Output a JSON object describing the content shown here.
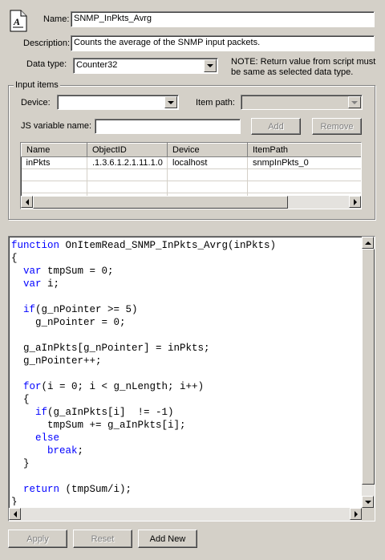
{
  "form": {
    "name_label": "Name:",
    "name_value": "SNMP_InPkts_Avrg",
    "description_label": "Description:",
    "description_value": "Counts the average of the SNMP input packets.",
    "datatype_label": "Data type:",
    "datatype_value": "Counter32",
    "note_line1": "NOTE: Return value from script must",
    "note_line2": "be same as selected data type."
  },
  "input_items": {
    "title": "Input items",
    "device_label": "Device:",
    "device_value": "",
    "itempath_label": "Item path:",
    "itempath_value": "",
    "jsvar_label": "JS variable name:",
    "jsvar_value": "",
    "add_label": "Add",
    "remove_label": "Remove",
    "columns": [
      "Name",
      "ObjectID",
      "Device",
      "ItemPath"
    ],
    "rows": [
      [
        "inPkts",
        ".1.3.6.1.2.1.11.1.0",
        "localhost",
        "snmpInPkts_0"
      ],
      [
        "",
        "",
        "",
        ""
      ],
      [
        "",
        "",
        "",
        ""
      ],
      [
        "",
        "",
        "",
        ""
      ]
    ]
  },
  "code": {
    "lines": [
      [
        {
          "t": "function",
          "k": 1
        },
        {
          "t": " OnItemRead_SNMP_InPkts_Avrg(inPkts)"
        }
      ],
      [
        {
          "t": "{"
        }
      ],
      [
        {
          "t": "  "
        },
        {
          "t": "var",
          "k": 1
        },
        {
          "t": " tmpSum = 0;"
        }
      ],
      [
        {
          "t": "  "
        },
        {
          "t": "var",
          "k": 1
        },
        {
          "t": " i;"
        }
      ],
      [
        {
          "t": ""
        }
      ],
      [
        {
          "t": "  "
        },
        {
          "t": "if",
          "k": 1
        },
        {
          "t": "(g_nPointer >= 5)"
        }
      ],
      [
        {
          "t": "    g_nPointer = 0;"
        }
      ],
      [
        {
          "t": ""
        }
      ],
      [
        {
          "t": "  g_aInPkts[g_nPointer] = inPkts;"
        }
      ],
      [
        {
          "t": "  g_nPointer++;"
        }
      ],
      [
        {
          "t": ""
        }
      ],
      [
        {
          "t": "  "
        },
        {
          "t": "for",
          "k": 1
        },
        {
          "t": "(i = 0; i < g_nLength; i++)"
        }
      ],
      [
        {
          "t": "  {"
        }
      ],
      [
        {
          "t": "    "
        },
        {
          "t": "if",
          "k": 1
        },
        {
          "t": "(g_aInPkts[i]  != -1)"
        }
      ],
      [
        {
          "t": "      tmpSum += g_aInPkts[i];"
        }
      ],
      [
        {
          "t": "    "
        },
        {
          "t": "else",
          "k": 1
        }
      ],
      [
        {
          "t": "      "
        },
        {
          "t": "break",
          "k": 1
        },
        {
          "t": ";"
        }
      ],
      [
        {
          "t": "  }"
        }
      ],
      [
        {
          "t": ""
        }
      ],
      [
        {
          "t": "  "
        },
        {
          "t": "return",
          "k": 1
        },
        {
          "t": " (tmpSum/i);"
        }
      ],
      [
        {
          "t": "}"
        }
      ]
    ]
  },
  "footer": {
    "apply_label": "Apply",
    "reset_label": "Reset",
    "addnew_label": "Add New"
  },
  "colors": {
    "keyword": "#0000ff",
    "face": "#d4d0c8"
  },
  "icons": {
    "header": "script-document-icon"
  }
}
